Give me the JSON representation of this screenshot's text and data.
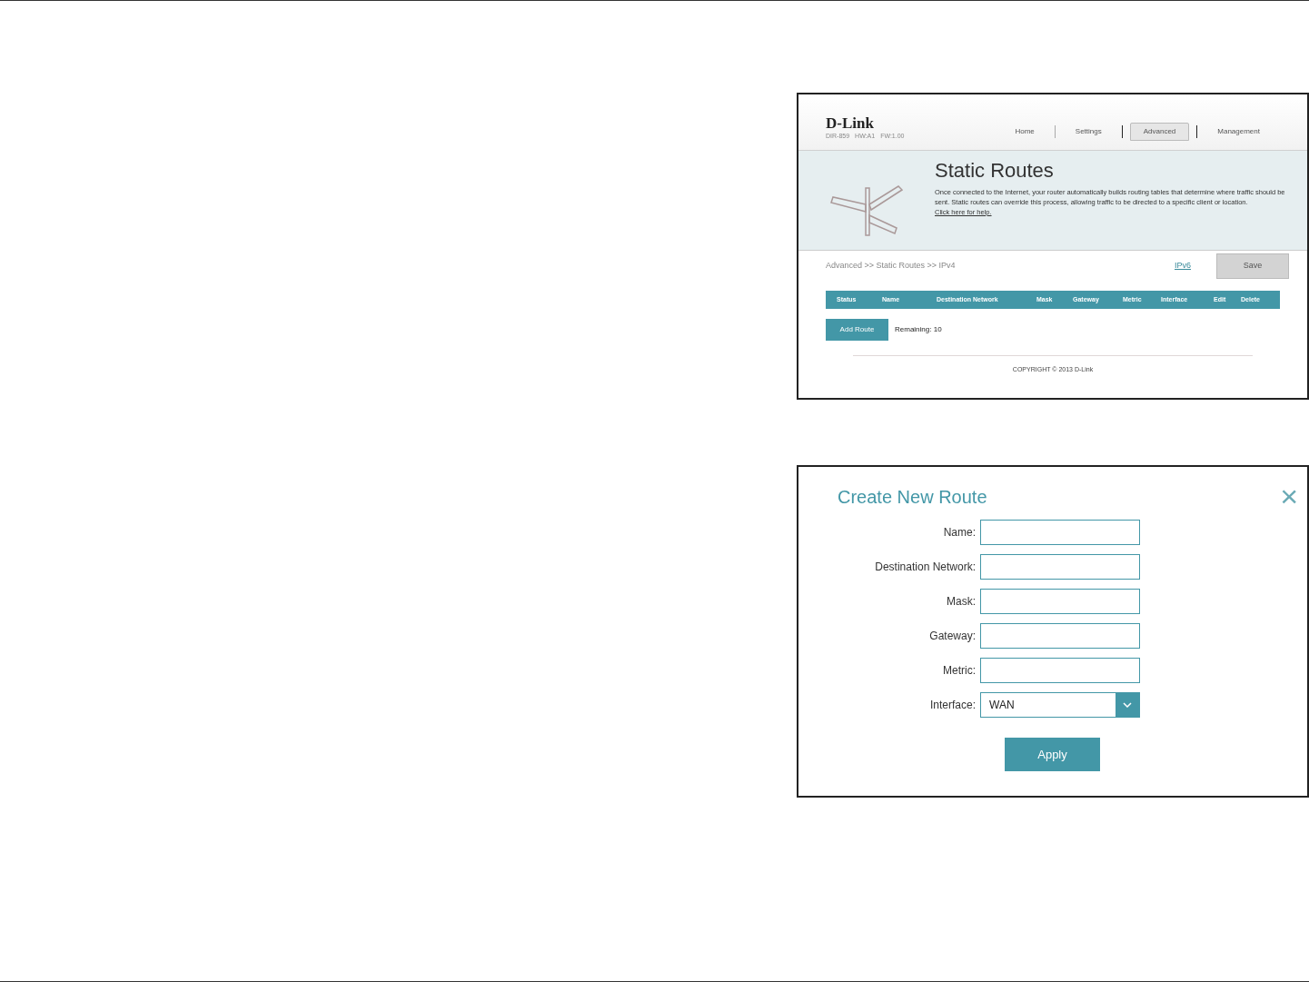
{
  "static_routes_screen": {
    "logo": "D-Link",
    "device_info": [
      "DIR-859",
      "HW:A1",
      "FW:1.00"
    ],
    "nav_tabs": [
      {
        "label": "Home",
        "selected": false
      },
      {
        "label": "Settings",
        "selected": false
      },
      {
        "label": "Advanced",
        "selected": true
      },
      {
        "label": "Management",
        "selected": false
      }
    ],
    "title": "Static Routes",
    "description": "Once connected to the Internet, your router automatically builds routing tables that determine where traffic should be sent. Static routes can override this process, allowing traffic to be directed to a specific client or location.",
    "help_link": "Click here for help.",
    "breadcrumb": "Advanced >> Static Routes >> IPv4",
    "ipv6_link": "IPv6",
    "save_button": {
      "label": "Save",
      "disabled": true
    },
    "table": {
      "columns": [
        "Status",
        "Name",
        "Destination Network",
        "Mask",
        "Gateway",
        "Metric",
        "Interface",
        "Edit",
        "Delete"
      ]
    },
    "add_button": "Add Route",
    "remaining": "Remaining: 10",
    "copyright": "COPYRIGHT © 2013 D-Link"
  },
  "create_route_dialog": {
    "title": "Create New Route",
    "close": "×",
    "fields": [
      {
        "label": "Name:",
        "kind": "text"
      },
      {
        "label": "Destination Network:",
        "kind": "text"
      },
      {
        "label": "Mask:",
        "kind": "text"
      },
      {
        "label": "Gateway:",
        "kind": "text"
      },
      {
        "label": "Metric:",
        "kind": "text"
      },
      {
        "label": "Interface:",
        "kind": "select",
        "value": "WAN"
      }
    ],
    "apply_button": "Apply"
  }
}
